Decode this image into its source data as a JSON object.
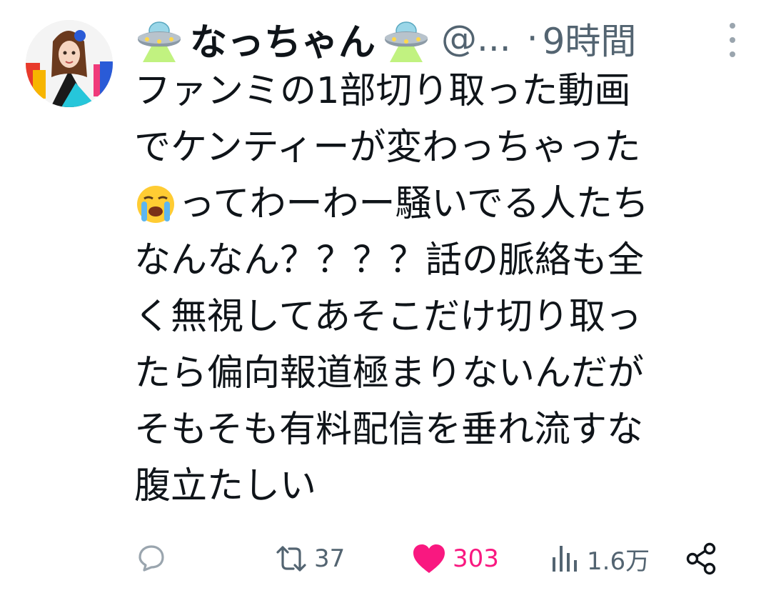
{
  "post": {
    "author": {
      "display_name": "なっちゃん",
      "handle": "@...",
      "badge_icons": [
        "ufo-emoji",
        "ufo-emoji"
      ]
    },
    "separator": "·",
    "time": "9時間",
    "text_lines": [
      "ファンミの1部切り取った動画",
      "でケンティーが変わっちゃった",
      "ってわーわー騒いでる人たち",
      "なんなん？？？？話の脈絡も全",
      "く無視してあそこだけ切り取っ",
      "たら偏向報道極まりないんだが",
      "そもそも有料配信を垂れ流すな",
      "腹立たしい"
    ],
    "inline_emoji": "loudly-crying-face-emoji",
    "actions": {
      "replies": "",
      "reposts": "37",
      "likes": "303",
      "views": "1.6万"
    }
  },
  "colors": {
    "text": "#0f1419",
    "secondary": "#536471",
    "like": "#f91880"
  }
}
